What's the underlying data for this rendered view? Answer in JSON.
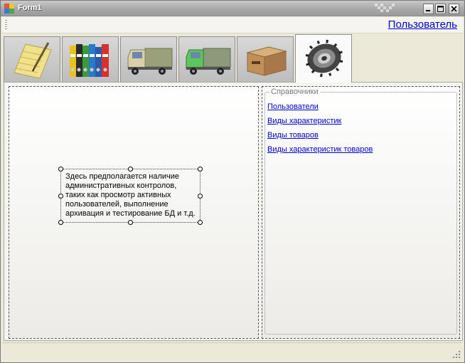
{
  "window": {
    "title": "Form1"
  },
  "menubar": {
    "user_link": "Пользователь"
  },
  "tabs": [
    {
      "icon": "notepad-icon",
      "active": false
    },
    {
      "icon": "binders-icon",
      "active": false
    },
    {
      "icon": "truck-icon",
      "active": false
    },
    {
      "icon": "green-truck-icon",
      "active": false
    },
    {
      "icon": "cardboard-box-icon",
      "active": false
    },
    {
      "icon": "gear-icon",
      "active": true
    }
  ],
  "admin_panel": {
    "description": "Здесь предполагается наличие административных контролов, таких как просмотр активных пользователей, выполнение архивация и тестирование БД и т.д."
  },
  "references": {
    "title": "Справочники",
    "links": [
      "Пользователи",
      "Виды характеристик",
      "Виды товаров",
      "Виды характеристик товаров"
    ]
  },
  "colors": {
    "link": "#0000cc",
    "titlebar": "#a8a8a8",
    "window_bg": "#ece9d8"
  }
}
